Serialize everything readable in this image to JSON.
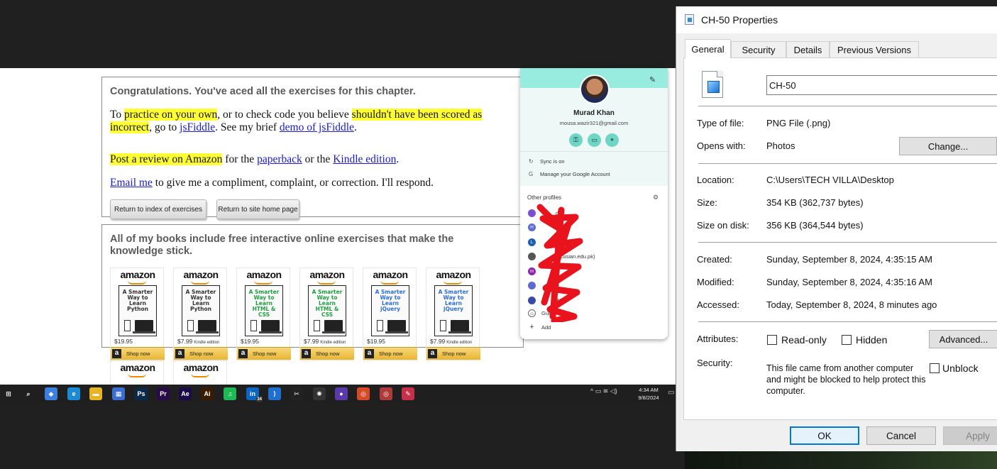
{
  "webpage": {
    "congrats_heading": "Congratulations. You've aced all the exercises for this chapter.",
    "p1": {
      "t1": "To ",
      "hl1": "practice on your own",
      "t2": ", or to check code you believe ",
      "hl2": "shouldn't have been scored as incorrect",
      "t3": ", go to ",
      "link1": "jsFiddle",
      "t4": ". See my brief ",
      "link2": "demo of jsFiddle",
      "t5": "."
    },
    "p2": {
      "hl": "Post a review on Amazon",
      "t1": " for the ",
      "link1": "paperback",
      "t2": " or the ",
      "link2": "Kindle edition",
      "t3": "."
    },
    "p3": {
      "link": "Email me",
      "t1": " to give me a compliment, complaint, or correction. I'll respond."
    },
    "btn_index": "Return to index of exercises",
    "btn_home": "Return to site home page",
    "books_heading": "All of my books include free interactive online exercises that make the knowledge stick.",
    "books": [
      {
        "brand": "amazon",
        "cover": "A Smarter Way to Learn Python",
        "price": "$19.95",
        "edition": "",
        "shop": "Shop now"
      },
      {
        "brand": "amazon",
        "cover": "A Smarter Way to Learn Python",
        "price": "$7.99",
        "edition": "Kindle edition",
        "shop": "Shop now"
      },
      {
        "brand": "amazon",
        "cover": "A Smarter Way to Learn HTML & CSS",
        "price": "$19.95",
        "edition": "",
        "shop": "Shop now"
      },
      {
        "brand": "amazon",
        "cover": "A Smarter Way to Learn HTML & CSS",
        "price": "$7.99",
        "edition": "Kindle edition",
        "shop": "Shop now"
      },
      {
        "brand": "amazon",
        "cover": "A Smarter Way to Learn jQuery",
        "price": "$19.95",
        "edition": "",
        "shop": "Shop now"
      },
      {
        "brand": "amazon",
        "cover": "A Smarter Way to Learn jQuery",
        "price": "$7.99",
        "edition": "Kindle edition",
        "shop": "Shop now"
      }
    ],
    "books_row2": [
      {
        "brand": "amazon"
      },
      {
        "brand": "amazon"
      }
    ]
  },
  "profile_popup": {
    "header_partial": "Murad",
    "name": "Murad Khan",
    "email": "mousa.wazir321@gmail.com",
    "sync": "Sync is on",
    "manage": "Manage your Google Account",
    "other_profiles": "Other profiles",
    "profiles": [
      {
        "initial": "",
        "label": "d",
        "color": "#7a4fd6"
      },
      {
        "initial": "H",
        "label": "ork)",
        "color": "#5b6bd1"
      },
      {
        "initial": "L",
        "label": "",
        "color": "#1a5fb4"
      },
      {
        "initial": "",
        "label": "(ecusian.edu.pk)",
        "color": "#555555"
      },
      {
        "initial": "m",
        "label": ")",
        "color": "#8e24aa"
      },
      {
        "initial": "",
        "label": "R",
        "color": "#5b6bd1"
      },
      {
        "initial": "",
        "label": "W",
        "color": "#3949ab"
      }
    ],
    "guest": "Guest",
    "add": "Add",
    "colors": {
      "band": "#98ebdf",
      "scribble": "#e8131d"
    }
  },
  "taskbar": {
    "apps": [
      {
        "name": "windows-start-icon",
        "glyph": "⊞",
        "color": "#1f1f1f"
      },
      {
        "name": "search-icon",
        "glyph": "⌕",
        "color": "#1f1f1f"
      },
      {
        "name": "copilot-icon",
        "glyph": "◆",
        "color": "#3b7fe0"
      },
      {
        "name": "edge-icon",
        "glyph": "e",
        "color": "#1b8bd6"
      },
      {
        "name": "file-explorer-icon",
        "glyph": "▬",
        "color": "#e8b325"
      },
      {
        "name": "store-icon",
        "glyph": "▦",
        "color": "#3a6fd0"
      },
      {
        "name": "photoshop-icon",
        "glyph": "Ps",
        "color": "#0b2a4a"
      },
      {
        "name": "premiere-icon",
        "glyph": "Pr",
        "color": "#2a0a4a"
      },
      {
        "name": "after-effects-icon",
        "glyph": "Ae",
        "color": "#1a0a4a"
      },
      {
        "name": "illustrator-icon",
        "glyph": "Ai",
        "color": "#3a1a00"
      },
      {
        "name": "spotify-icon",
        "glyph": "♫",
        "color": "#1db954"
      },
      {
        "name": "linkedin-icon",
        "glyph": "in",
        "color": "#0a66c2"
      },
      {
        "name": "vscode-icon",
        "glyph": "⟩",
        "color": "#1f6fd0"
      },
      {
        "name": "capcut-icon",
        "glyph": "✂",
        "color": "#222222"
      },
      {
        "name": "chatgpt-icon",
        "glyph": "✺",
        "color": "#333333"
      },
      {
        "name": "github-icon",
        "glyph": "●",
        "color": "#5a3aa8"
      },
      {
        "name": "chrome-icon",
        "glyph": "◎",
        "color": "#d64a2a"
      },
      {
        "name": "chrome-profile-icon",
        "glyph": "◎",
        "color": "#b03a3a"
      },
      {
        "name": "snipping-tool-icon",
        "glyph": "✎",
        "color": "#c8304a"
      }
    ],
    "linkedin_badge": "34",
    "time": "4:34 AM",
    "date": "9/8/2024"
  },
  "properties": {
    "title": "CH-50 Properties",
    "tabs": [
      "General",
      "Security",
      "Details",
      "Previous Versions"
    ],
    "filename": "CH-50",
    "type_label": "Type of file:",
    "type_value": "PNG File (.png)",
    "opens_label": "Opens with:",
    "opens_value": "Photos",
    "change": "Change...",
    "location_label": "Location:",
    "location_value": "C:\\Users\\TECH VILLA\\Desktop",
    "size_label": "Size:",
    "size_value": "354 KB (362,737 bytes)",
    "disk_label": "Size on disk:",
    "disk_value": "356 KB (364,544 bytes)",
    "created_label": "Created:",
    "created_value": "Sunday, September 8, 2024, 4:35:15 AM",
    "modified_label": "Modified:",
    "modified_value": "Sunday, September 8, 2024, 4:35:16 AM",
    "accessed_label": "Accessed:",
    "accessed_value": "Today, September 8, 2024, 8 minutes ago",
    "attributes_label": "Attributes:",
    "readonly": "Read-only",
    "hidden": "Hidden",
    "advanced": "Advanced...",
    "security_label": "Security:",
    "security_text": "This file came from another computer and might be blocked to help protect this computer.",
    "unblock": "Unblock",
    "ok": "OK",
    "cancel": "Cancel",
    "apply": "Apply"
  }
}
